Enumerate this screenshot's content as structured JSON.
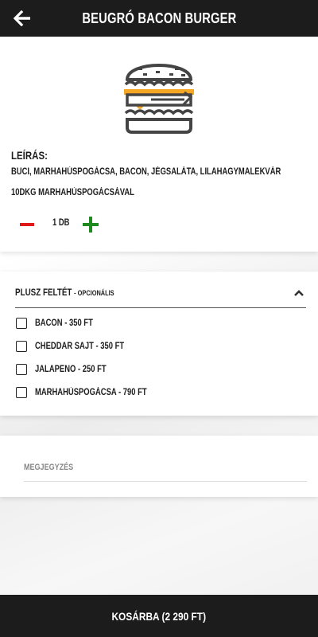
{
  "header": {
    "title": "BEUGRÓ BACON BURGER",
    "back_icon": "arrow-left-icon"
  },
  "product": {
    "image_icon": "burger-icon",
    "description_heading": "LEÍRÁS:",
    "description": "BUCI, MARHAHÚSPOGÁCSA, BACON, JÉGSALÁTA, LILAHAGYMALEKVÁR",
    "extra_info": "10DKG MARHAHÚSPOGÁCSÁVAL",
    "quantity": "1 DB",
    "colors": {
      "minus": "#e01818",
      "plus": "#1f8a1f",
      "cheese": "#f5a623"
    }
  },
  "extras": {
    "title": "PLUSZ FELTÉT",
    "subtitle": "- OPCIONÁLIS",
    "options": [
      {
        "label": "BACON - 350 FT",
        "checked": false
      },
      {
        "label": "CHEDDAR SAJT - 350 FT",
        "checked": false
      },
      {
        "label": "JALAPENO - 250 FT",
        "checked": false
      },
      {
        "label": "MARHAHÚSPOGÁCSA - 790 FT",
        "checked": false
      }
    ]
  },
  "note": {
    "placeholder": "MEGJEGYZÉS"
  },
  "footer": {
    "cart_button": "KOSÁRBA (2 290 FT)"
  }
}
